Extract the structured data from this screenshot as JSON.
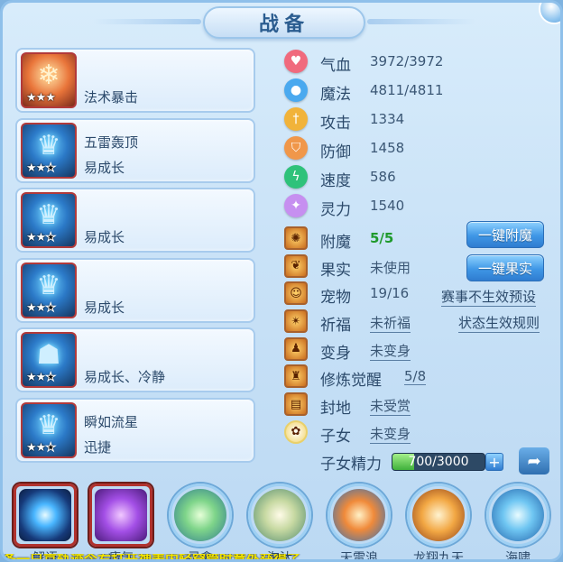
{
  "title": "战备",
  "left_list": [
    {
      "icon": "snowflake-popsicle-icon",
      "stars": [
        1,
        1,
        1
      ],
      "line1": "",
      "line2": "法术暴击"
    },
    {
      "icon": "armor-icon",
      "stars": [
        1,
        1,
        0
      ],
      "line1": "五雷轰顶",
      "line2": "易成长"
    },
    {
      "icon": "armor-icon",
      "stars": [
        1,
        1,
        0
      ],
      "line1": "",
      "line2": "易成长"
    },
    {
      "icon": "armor-icon",
      "stars": [
        1,
        1,
        0
      ],
      "line1": "",
      "line2": "易成长"
    },
    {
      "icon": "helmet-icon",
      "stars": [
        1,
        1,
        0
      ],
      "line1": "",
      "line2": "易成长、冷静"
    },
    {
      "icon": "armor-icon",
      "stars": [
        1,
        1,
        0
      ],
      "line1": "瞬如流星",
      "line2": "迅捷"
    }
  ],
  "stats": [
    {
      "label": "气血",
      "value": "3972/3972",
      "icon": "heart-icon",
      "color": "#f06a7d"
    },
    {
      "label": "魔法",
      "value": "4811/4811",
      "icon": "mana-icon",
      "color": "#4aa9ef"
    },
    {
      "label": "攻击",
      "value": "1334",
      "icon": "sword-icon",
      "color": "#f1b33a"
    },
    {
      "label": "防御",
      "value": "1458",
      "icon": "shield-icon",
      "color": "#f0974a"
    },
    {
      "label": "速度",
      "value": "586",
      "icon": "lightning-icon",
      "color": "#2ec27a"
    },
    {
      "label": "灵力",
      "value": "1540",
      "icon": "spirit-icon",
      "color": "#c68ff0"
    }
  ],
  "systems": [
    {
      "label": "附魔",
      "value": "5/5",
      "icon": "enchant-icon",
      "style": "green"
    },
    {
      "label": "果实",
      "value": "未使用",
      "icon": "fruit-icon",
      "style": ""
    },
    {
      "label": "宠物",
      "value": "19/16",
      "icon": "pet-icon",
      "style": ""
    },
    {
      "label": "祈福",
      "value": "未祈福",
      "icon": "pray-icon",
      "style": "underline"
    },
    {
      "label": "变身",
      "value": "未变身",
      "icon": "transform-icon",
      "style": "underline"
    },
    {
      "label": "修炼觉醒",
      "value": "5/8",
      "icon": "cultivate-icon",
      "style": "underline far"
    },
    {
      "label": "封地",
      "value": "未受赏",
      "icon": "fief-icon",
      "style": "underline"
    },
    {
      "label": "子女",
      "value": "未变身",
      "icon": "child-icon",
      "style": "underline"
    }
  ],
  "buttons": {
    "enchant": "一键附魔",
    "fruit": "一键果实",
    "preset": "赛事不生效预设",
    "rules": "状态生效规则"
  },
  "energy": {
    "label": "子女精力",
    "text": "700/3000",
    "current": 700,
    "max": 3000,
    "plus": "+"
  },
  "skills": [
    {
      "label": "解语",
      "icon": "orb-icon",
      "shape": "square",
      "bg": "radial-gradient(circle, #e8fbff 0%, #49b6ff 30%, #163a7a 70%, #0b1d3f 100%)"
    },
    {
      "label": "瘴气",
      "icon": "miasma-icon",
      "shape": "square",
      "bg": "radial-gradient(circle, #f1c8ff 0%, #a34fe6 45%, #4b1b7a 100%)"
    },
    {
      "label": "灵愈",
      "icon": "heal-icon",
      "shape": "round",
      "bg": "radial-gradient(circle, #e6ffd8 0%, #7fd58a 40%, #2d7a8e 100%)"
    },
    {
      "label": "淘汰",
      "icon": "blade-icon",
      "shape": "round",
      "bg": "radial-gradient(circle, #fffbe8 0%, #c7d9a2 40%, #4f8a6d 100%)"
    },
    {
      "label": "天雷浪",
      "icon": "wave-icon",
      "shape": "round",
      "bg": "radial-gradient(circle, #fff1c6 0%, #f08a3a 40%, #2d6fb8 100%)"
    },
    {
      "label": "龙翔九天",
      "icon": "monk-icon",
      "shape": "round",
      "bg": "radial-gradient(circle, #fff3d0 0%, #f2a743 45%, #8a3b17 100%)"
    },
    {
      "label": "海啸",
      "icon": "dragon-icon",
      "shape": "round",
      "bg": "radial-gradient(circle, #e8fbff 0%, #6fc6f2 40%, #1f5fa8 100%)"
    }
  ],
  "ticker": "条一只京轨迹今右打开神表内轻穿管时意外获得了"
}
